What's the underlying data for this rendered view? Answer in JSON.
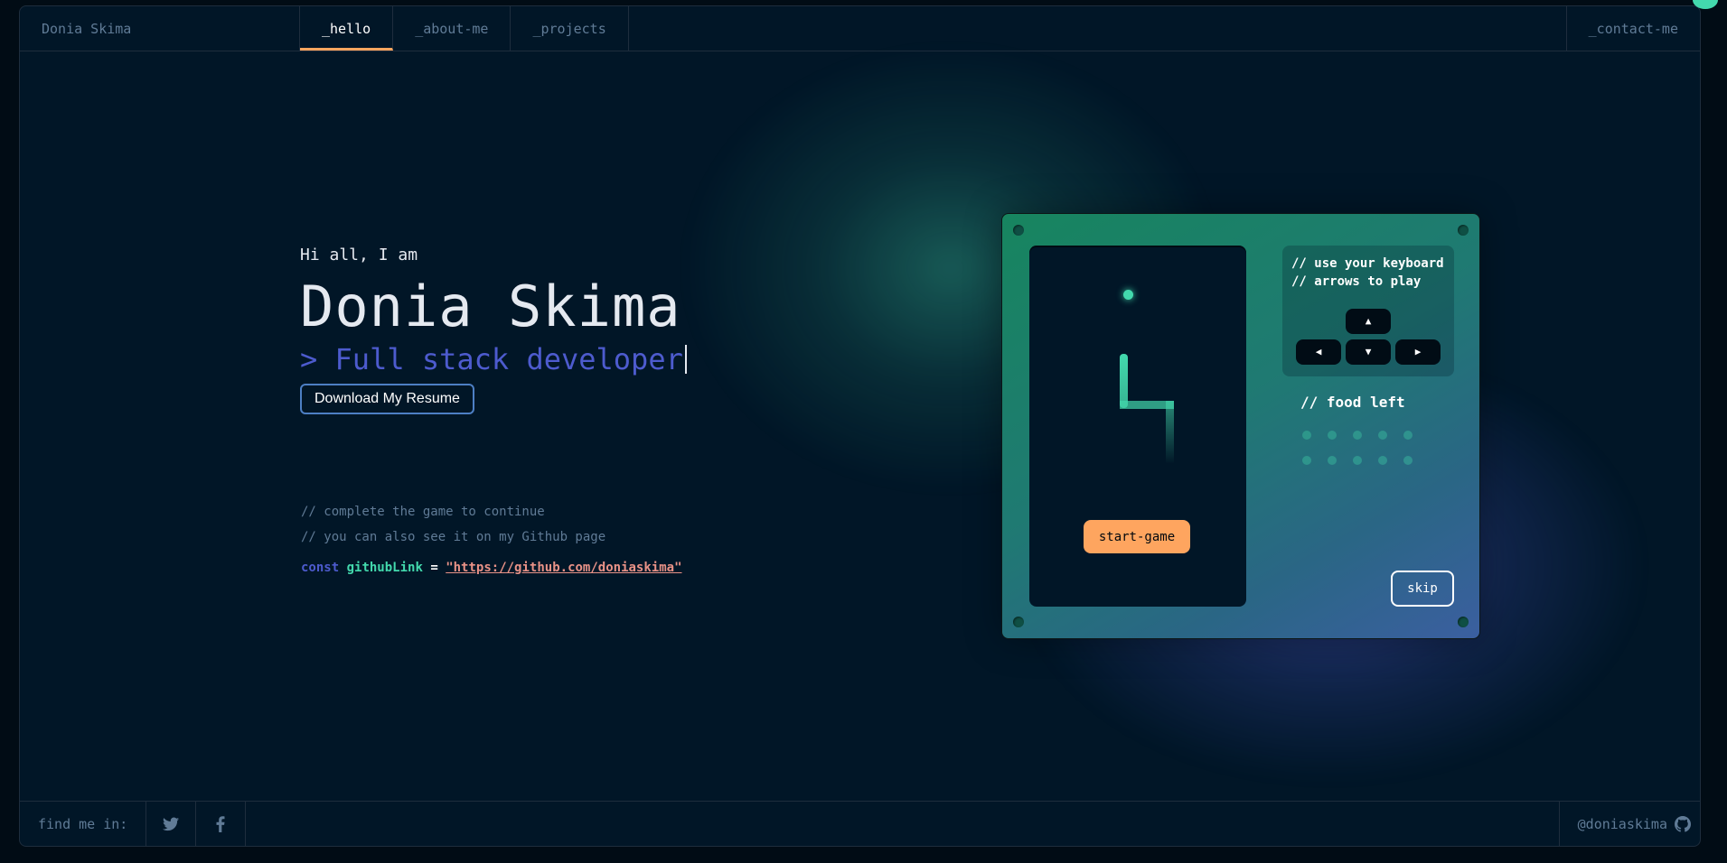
{
  "header": {
    "brand": "Donia Skima",
    "tabs": [
      {
        "label": "_hello",
        "active": true
      },
      {
        "label": "_about-me",
        "active": false
      },
      {
        "label": "_projects",
        "active": false
      }
    ],
    "contact": "_contact-me"
  },
  "hero": {
    "greeting": "Hi all, I am",
    "name": "Donia Skima",
    "role": "> Full stack developer",
    "resume_button": "Download My Resume"
  },
  "comments": {
    "line1": "// complete the game to continue",
    "line2": "// you can also see it on my Github page",
    "code": {
      "keyword": "const",
      "variable": "githubLink",
      "operator": "=",
      "value": "\"https://github.com/doniaskima\""
    }
  },
  "game": {
    "instructions_line1": "// use your keyboard",
    "instructions_line2": "// arrows to play",
    "food_left_label": "// food left",
    "food_count": 10,
    "start_button": "start-game",
    "skip_button": "skip",
    "keys": {
      "up": "▲",
      "left": "◀",
      "down": "▼",
      "right": "▶"
    }
  },
  "footer": {
    "find_label": "find me in:",
    "handle": "@doniaskima",
    "socials": [
      "twitter-icon",
      "facebook-icon"
    ]
  },
  "colors": {
    "background": "#011627",
    "accent_orange": "#fea55f",
    "accent_green": "#43d9ad",
    "accent_blue": "#4d5bce",
    "string_red": "#e99287"
  }
}
